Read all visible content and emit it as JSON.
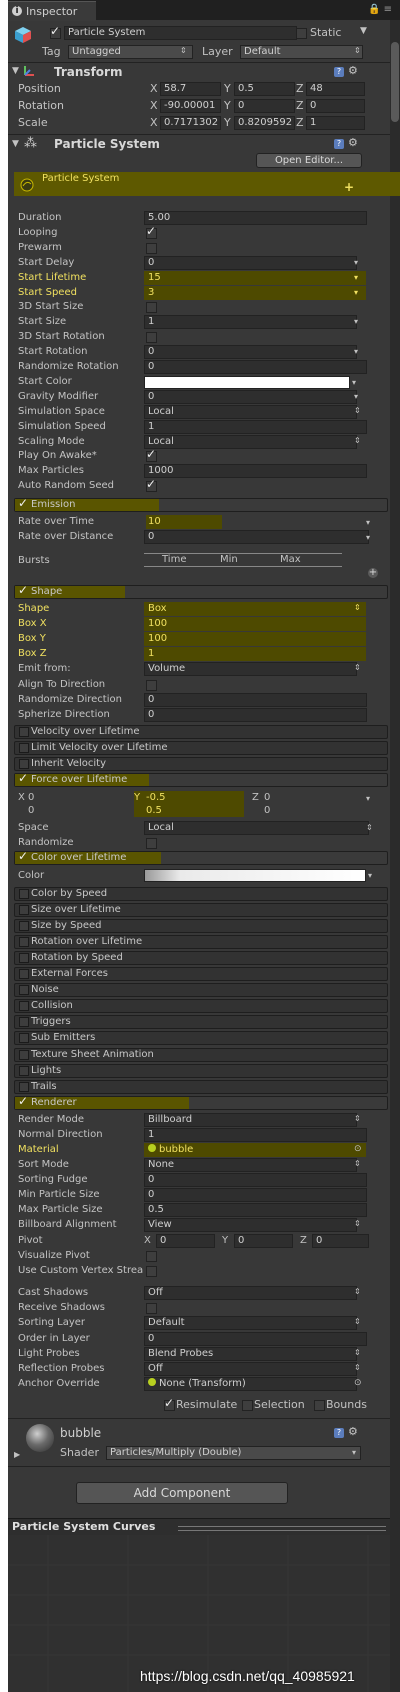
{
  "window": {
    "tab_title": "Inspector",
    "tab_icon": "info-icon"
  },
  "object": {
    "name": "Particle System",
    "active": true,
    "static_label": "Static",
    "tag_label": "Tag",
    "tag_value": "Untagged",
    "layer_label": "Layer",
    "layer_value": "Default"
  },
  "transform": {
    "title": "Transform",
    "position_label": "Position",
    "rotation_label": "Rotation",
    "scale_label": "Scale",
    "axis_x": "X",
    "axis_y": "Y",
    "axis_z": "Z",
    "position": [
      "58.7",
      "0.5",
      "48"
    ],
    "rotation": [
      "-90.00001",
      "0",
      "0"
    ],
    "scale": [
      "0.7171302",
      "0.8209592",
      "1"
    ]
  },
  "particle_system": {
    "title": "Particle System",
    "open_editor_label": "Open Editor...",
    "main_module_title": "Particle System",
    "properties": [
      {
        "label": "Duration",
        "value": "5.00",
        "type": "text"
      },
      {
        "label": "Looping",
        "value": true,
        "type": "check"
      },
      {
        "label": "Prewarm",
        "value": false,
        "type": "check"
      },
      {
        "label": "Start Delay",
        "value": "0",
        "type": "drop"
      },
      {
        "label": "Start Lifetime",
        "value": "15",
        "type": "drop",
        "highlight": true
      },
      {
        "label": "Start Speed",
        "value": "3",
        "type": "drop",
        "highlight": true
      },
      {
        "label": "3D Start Size",
        "value": false,
        "type": "check"
      },
      {
        "label": "Start Size",
        "value": "1",
        "type": "drop"
      },
      {
        "label": "3D Start Rotation",
        "value": false,
        "type": "check"
      },
      {
        "label": "Start Rotation",
        "value": "0",
        "type": "drop"
      },
      {
        "label": "Randomize Rotation",
        "value": "0",
        "type": "text"
      },
      {
        "label": "Start Color",
        "value": "",
        "type": "color"
      },
      {
        "label": "Gravity Modifier",
        "value": "0",
        "type": "drop"
      },
      {
        "label": "Simulation Space",
        "value": "Local",
        "type": "select"
      },
      {
        "label": "Simulation Speed",
        "value": "1",
        "type": "text"
      },
      {
        "label": "Scaling Mode",
        "value": "Local",
        "type": "select"
      },
      {
        "label": "Play On Awake*",
        "value": true,
        "type": "check"
      },
      {
        "label": "Max Particles",
        "value": "1000",
        "type": "text"
      },
      {
        "label": "Auto Random Seed",
        "value": true,
        "type": "check"
      }
    ],
    "emission": {
      "title": "Emission",
      "rate_time_label": "Rate over Time",
      "rate_time_value": "10",
      "rate_distance_label": "Rate over Distance",
      "rate_distance_value": "0",
      "bursts_label": "Bursts",
      "bursts_columns": [
        "Time",
        "Min",
        "Max"
      ]
    },
    "shape": {
      "title": "Shape",
      "rows": [
        {
          "label": "Shape",
          "value": "Box",
          "type": "select",
          "highlight": true
        },
        {
          "label": "Box X",
          "value": "100",
          "type": "text",
          "highlight": true
        },
        {
          "label": "Box Y",
          "value": "100",
          "type": "text",
          "highlight": true
        },
        {
          "label": "Box Z",
          "value": "1",
          "type": "text",
          "highlight": true
        },
        {
          "label": "Emit from:",
          "value": "Volume",
          "type": "select"
        },
        {
          "label": "Align To Direction",
          "value": false,
          "type": "check"
        },
        {
          "label": "Randomize Direction",
          "value": "0",
          "type": "text"
        },
        {
          "label": "Spherize Direction",
          "value": "0",
          "type": "text"
        }
      ]
    },
    "modules_a": [
      "Velocity over Lifetime",
      "Limit Velocity over Lifetime",
      "Inherit Velocity"
    ],
    "force": {
      "title": "Force over Lifetime",
      "x_label": "X",
      "y_label": "Y",
      "z_label": "Z",
      "x1": "0",
      "x2": "0",
      "y1": "-0.5",
      "y2": "0.5",
      "z1": "0",
      "z2": "0",
      "space_label": "Space",
      "space_value": "Local",
      "randomize_label": "Randomize"
    },
    "color_over_lifetime": {
      "title": "Color over Lifetime",
      "color_label": "Color"
    },
    "modules_b": [
      "Color by Speed",
      "Size over Lifetime",
      "Size by Speed",
      "Rotation over Lifetime",
      "Rotation by Speed",
      "External Forces",
      "Noise",
      "Collision",
      "Triggers",
      "Sub Emitters",
      "Texture Sheet Animation",
      "Lights",
      "Trails"
    ],
    "renderer": {
      "title": "Renderer",
      "rows": [
        {
          "label": "Render Mode",
          "value": "Billboard",
          "type": "select"
        },
        {
          "label": "Normal Direction",
          "value": "1",
          "type": "text"
        },
        {
          "label": "Material",
          "value": "bubble",
          "type": "object",
          "highlight": true
        },
        {
          "label": "Sort Mode",
          "value": "None",
          "type": "select"
        },
        {
          "label": "Sorting Fudge",
          "value": "0",
          "type": "text"
        },
        {
          "label": "Min Particle Size",
          "value": "0",
          "type": "text"
        },
        {
          "label": "Max Particle Size",
          "value": "0.5",
          "type": "text"
        },
        {
          "label": "Billboard Alignment",
          "value": "View",
          "type": "select"
        }
      ],
      "pivot_label": "Pivot",
      "pivot": [
        "0",
        "0",
        "0"
      ],
      "visualize_pivot_label": "Visualize Pivot",
      "custom_vertex_label": "Use Custom Vertex Strea",
      "rows2": [
        {
          "label": "Cast Shadows",
          "value": "Off",
          "type": "select"
        },
        {
          "label": "Receive Shadows",
          "value": false,
          "type": "check"
        },
        {
          "label": "Sorting Layer",
          "value": "Default",
          "type": "select"
        },
        {
          "label": "Order in Layer",
          "value": "0",
          "type": "text"
        },
        {
          "label": "Light Probes",
          "value": "Blend Probes",
          "type": "select"
        },
        {
          "label": "Reflection Probes",
          "value": "Off",
          "type": "select"
        },
        {
          "label": "Anchor Override",
          "value": "None (Transform)",
          "type": "object"
        }
      ]
    },
    "footer": {
      "resimulate_label": "Resimulate",
      "selection_label": "Selection",
      "bounds_label": "Bounds"
    }
  },
  "material": {
    "name": "bubble",
    "shader_label": "Shader",
    "shader_value": "Particles/Multiply (Double)"
  },
  "add_component_label": "Add Component",
  "curves_title": "Particle System Curves",
  "watermark": "https://blog.csdn.net/qq_40985921",
  "colors": {
    "highlight": "#4e4a00",
    "highlight_text": "#f0e060",
    "panel_bg": "#383838"
  }
}
